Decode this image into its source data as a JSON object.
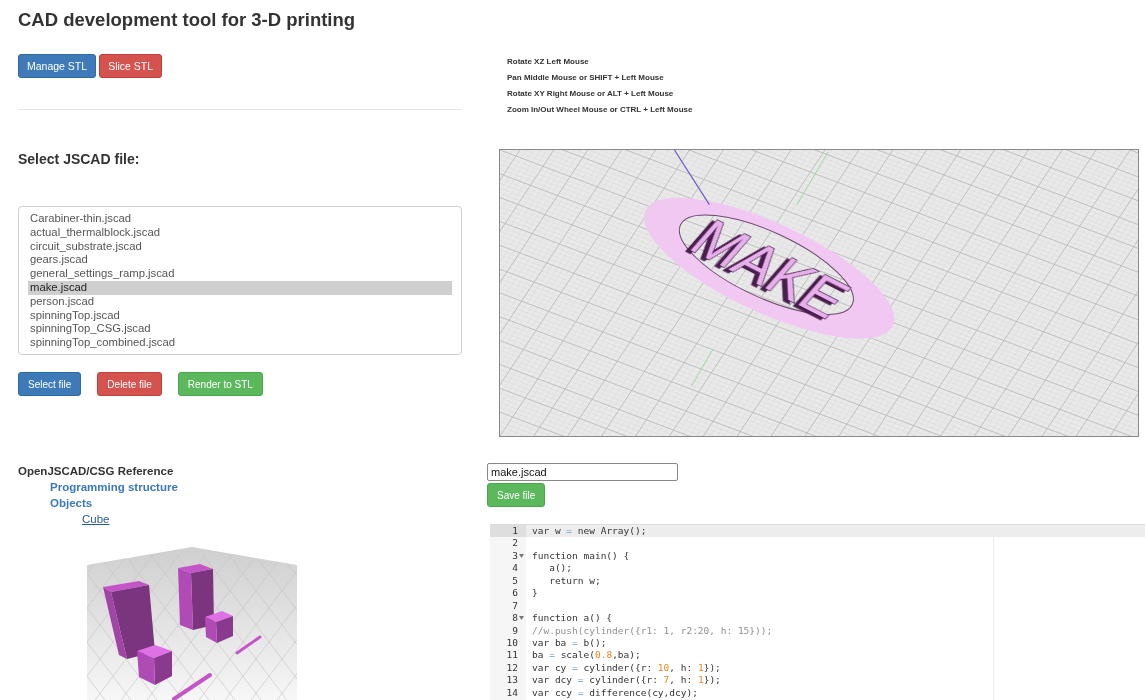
{
  "page": {
    "title": "CAD development tool for 3-D printing"
  },
  "top_buttons": [
    {
      "label": "Manage STL",
      "kind": "primary"
    },
    {
      "label": "Slice STL",
      "kind": "danger"
    }
  ],
  "controls_help": [
    "Rotate XZ Left Mouse",
    "Pan Middle Mouse or SHIFT + Left Mouse",
    "Rotate XY Right Mouse or ALT + Left Mouse",
    "Zoom In/Out Wheel Mouse or CTRL + Left Mouse"
  ],
  "file_picker": {
    "heading": "Select JSCAD file:",
    "files": [
      {
        "name": "Carabiner-thin.jscad",
        "selected": false
      },
      {
        "name": "actual_thermalblock.jscad",
        "selected": false
      },
      {
        "name": "circuit_substrate.jscad",
        "selected": false
      },
      {
        "name": "gears.jscad",
        "selected": false
      },
      {
        "name": "general_settings_ramp.jscad",
        "selected": false
      },
      {
        "name": "make.jscad",
        "selected": true
      },
      {
        "name": "person.jscad",
        "selected": false
      },
      {
        "name": "spinningTop.jscad",
        "selected": false
      },
      {
        "name": "spinningTop_CSG.jscad",
        "selected": false
      },
      {
        "name": "spinningTop_combined.jscad",
        "selected": false
      }
    ],
    "buttons": [
      {
        "label": "Select file",
        "kind": "primary"
      },
      {
        "label": "Delete file",
        "kind": "danger"
      },
      {
        "label": "Render to STL",
        "kind": "success"
      }
    ]
  },
  "viewport": {
    "model_text": "MAKE"
  },
  "reference": {
    "title": "OpenJSCAD/CSG Reference",
    "items": [
      {
        "label": "Programming structure"
      },
      {
        "label": "Objects",
        "children": [
          {
            "label": "Cube"
          }
        ]
      }
    ]
  },
  "editor": {
    "file_name": "make.jscad",
    "save_button": {
      "label": "Save file",
      "kind": "success"
    },
    "lines": [
      {
        "number": "1",
        "active": true,
        "foldable": false,
        "tokens": [
          {
            "text": "var w ",
            "kind": "text"
          },
          {
            "text": "=",
            "kind": "operator"
          },
          {
            "text": " new Array();",
            "kind": "text"
          }
        ]
      },
      {
        "number": "2",
        "active": false,
        "foldable": false
      },
      {
        "number": "3",
        "active": false,
        "foldable": true,
        "tokens": [
          {
            "text": "function main() {",
            "kind": "text"
          }
        ]
      },
      {
        "number": "4",
        "active": false,
        "foldable": false,
        "tokens": [
          {
            "text": "   a();",
            "kind": "text"
          }
        ]
      },
      {
        "number": "5",
        "active": false,
        "foldable": false,
        "tokens": [
          {
            "text": "   return w;",
            "kind": "text"
          }
        ]
      },
      {
        "number": "6",
        "active": false,
        "foldable": false,
        "tokens": [
          {
            "text": "}",
            "kind": "text"
          }
        ]
      },
      {
        "number": "7",
        "active": false,
        "foldable": false
      },
      {
        "number": "8",
        "active": false,
        "foldable": true,
        "tokens": [
          {
            "text": "function a() {",
            "kind": "text"
          }
        ]
      },
      {
        "number": "9",
        "active": false,
        "foldable": false,
        "tokens": [
          {
            "text": "//w.push(cylinder({r1: 1, r2:20, h: 15}));",
            "kind": "comment"
          }
        ]
      },
      {
        "number": "10",
        "active": false,
        "foldable": false,
        "tokens": [
          {
            "text": "var ba ",
            "kind": "text"
          },
          {
            "text": "=",
            "kind": "operator"
          },
          {
            "text": " b();",
            "kind": "text"
          }
        ]
      },
      {
        "number": "11",
        "active": false,
        "foldable": false,
        "tokens": [
          {
            "text": "ba ",
            "kind": "text"
          },
          {
            "text": "=",
            "kind": "operator"
          },
          {
            "text": " scale(",
            "kind": "text"
          },
          {
            "text": "0.8",
            "kind": "number"
          },
          {
            "text": ",ba);",
            "kind": "text"
          }
        ]
      },
      {
        "number": "12",
        "active": false,
        "foldable": false,
        "tokens": [
          {
            "text": "var cy ",
            "kind": "text"
          },
          {
            "text": "=",
            "kind": "operator"
          },
          {
            "text": " cylinder({r: ",
            "kind": "text"
          },
          {
            "text": "10",
            "kind": "number"
          },
          {
            "text": ", h: ",
            "kind": "text"
          },
          {
            "text": "1",
            "kind": "number"
          },
          {
            "text": "});",
            "kind": "text"
          }
        ]
      },
      {
        "number": "13",
        "active": false,
        "foldable": false,
        "tokens": [
          {
            "text": "var dcy ",
            "kind": "text"
          },
          {
            "text": "=",
            "kind": "operator"
          },
          {
            "text": " cylinder({r: ",
            "kind": "text"
          },
          {
            "text": "7",
            "kind": "number"
          },
          {
            "text": ", h: ",
            "kind": "text"
          },
          {
            "text": "1",
            "kind": "number"
          },
          {
            "text": "});",
            "kind": "text"
          }
        ]
      },
      {
        "number": "14",
        "active": false,
        "foldable": false,
        "tokens": [
          {
            "text": "var ccy ",
            "kind": "text"
          },
          {
            "text": "=",
            "kind": "operator"
          },
          {
            "text": " difference(cy,dcy);",
            "kind": "text"
          }
        ]
      }
    ]
  }
}
